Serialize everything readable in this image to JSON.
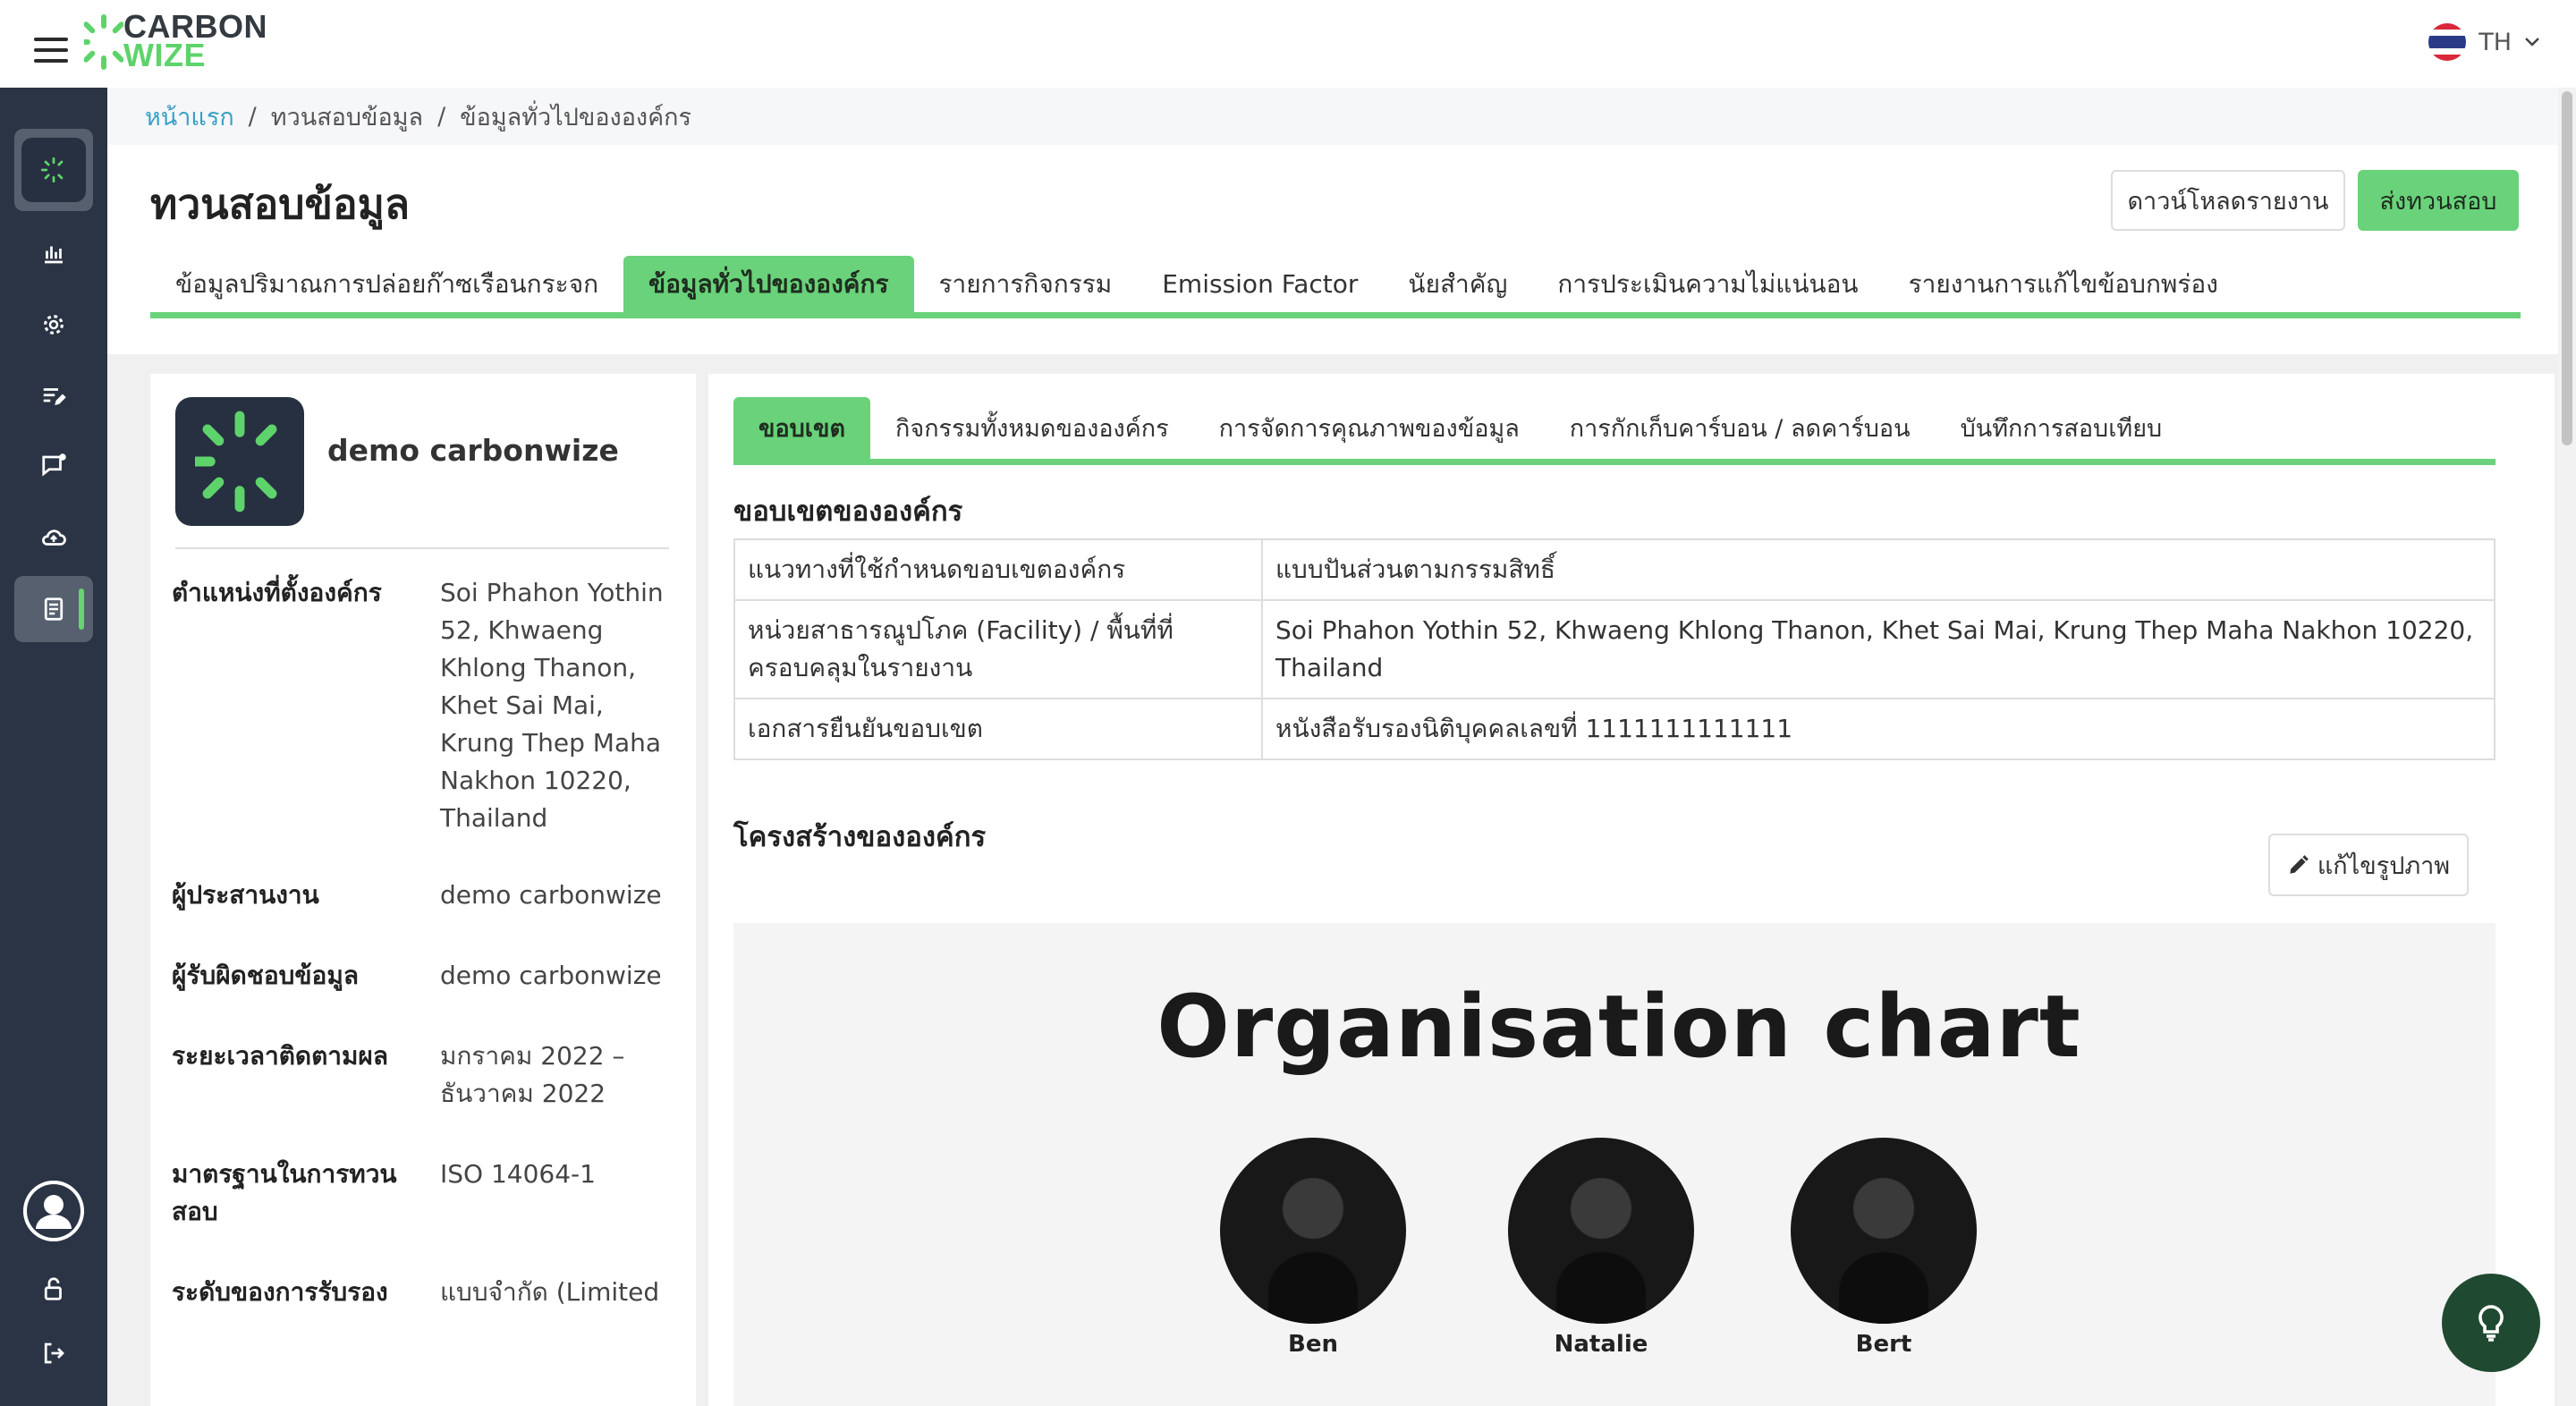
{
  "app": {
    "logo_line1": "CARBON",
    "logo_line2": "WIZE",
    "language": "TH"
  },
  "breadcrumb": {
    "home": "หน้าแรก",
    "level2": "ทวนสอบข้อมูล",
    "current": "ข้อมูลทั่วไปขององค์กร",
    "separator": "/"
  },
  "page": {
    "title": "ทวนสอบข้อมูล",
    "download_button": "ดาวน์โหลดรายงาน",
    "submit_button": "ส่งทวนสอบ"
  },
  "tabs": [
    {
      "label": "ข้อมูลปริมาณการปล่อยก๊าซเรือนกระจก",
      "active": false
    },
    {
      "label": "ข้อมูลทั่วไปขององค์กร",
      "active": true
    },
    {
      "label": "รายการกิจกรรม",
      "active": false
    },
    {
      "label": "Emission Factor",
      "active": false
    },
    {
      "label": "นัยสำคัญ",
      "active": false
    },
    {
      "label": "การประเมินความไม่แน่นอน",
      "active": false
    },
    {
      "label": "รายงานการแก้ไขข้อบกพร่อง",
      "active": false
    }
  ],
  "org": {
    "name": "demo carbonwize",
    "details": [
      {
        "label": "ตำแหน่งที่ตั้งองค์กร",
        "value": "Soi Phahon Yothin 52, Khwaeng Khlong Thanon, Khet Sai Mai, Krung Thep Maha Nakhon 10220, Thailand"
      },
      {
        "label": "ผู้ประสานงาน",
        "value": "demo carbonwize"
      },
      {
        "label": "ผู้รับผิดชอบข้อมูล",
        "value": "demo carbonwize"
      },
      {
        "label": "ระยะเวลาติดตามผล",
        "value": "มกราคม 2022 – ธันวาคม 2022"
      },
      {
        "label": "มาตรฐานในการทวนสอบ",
        "value": "ISO 14064-1"
      },
      {
        "label": "ระดับของการรับรอง",
        "value": "แบบจำกัด (Limited"
      }
    ]
  },
  "subtabs": [
    {
      "label": "ขอบเขต",
      "active": true
    },
    {
      "label": "กิจกรรมทั้งหมดขององค์กร",
      "active": false
    },
    {
      "label": "การจัดการคุณภาพของข้อมูล",
      "active": false
    },
    {
      "label": "การกักเก็บคาร์บอน / ลดคาร์บอน",
      "active": false
    },
    {
      "label": "บันทึกการสอบเทียบ",
      "active": false
    }
  ],
  "scope": {
    "title": "ขอบเขตขององค์กร",
    "rows": [
      {
        "label": "แนวทางที่ใช้กำหนดขอบเขตองค์กร",
        "value": "แบบปันส่วนตามกรรมสิทธิ์"
      },
      {
        "label": "หน่วยสาธารณูปโภค (Facility) / พื้นที่ที่ครอบคลุมในรายงาน",
        "value": "Soi Phahon Yothin 52, Khwaeng Khlong Thanon, Khet Sai Mai, Krung Thep Maha Nakhon 10220, Thailand"
      },
      {
        "label": "เอกสารยืนยันขอบเขต",
        "value": "หนังสือรับรองนิติบุคคลเลขที่ 1111111111111"
      }
    ]
  },
  "structure": {
    "title": "โครงสร้างขององค์กร",
    "edit_button": "แก้ไขรูปภาพ",
    "chart_title": "Organisation chart",
    "people": [
      "Ben",
      "Natalie",
      "Bert"
    ]
  },
  "colors": {
    "accent": "#69d27a",
    "sidebar": "#2b3445",
    "link": "#3aa0c7",
    "fab": "#1f4a31"
  },
  "icons": {
    "sidebar": [
      "dashboard-logo-icon",
      "bar-chart-icon",
      "settings-gear-icon",
      "edit-list-icon",
      "chat-icon",
      "cloud-upload-icon",
      "report-document-icon",
      "user-avatar-icon",
      "unlock-icon",
      "logout-icon"
    ],
    "fab": "lightbulb-icon"
  }
}
